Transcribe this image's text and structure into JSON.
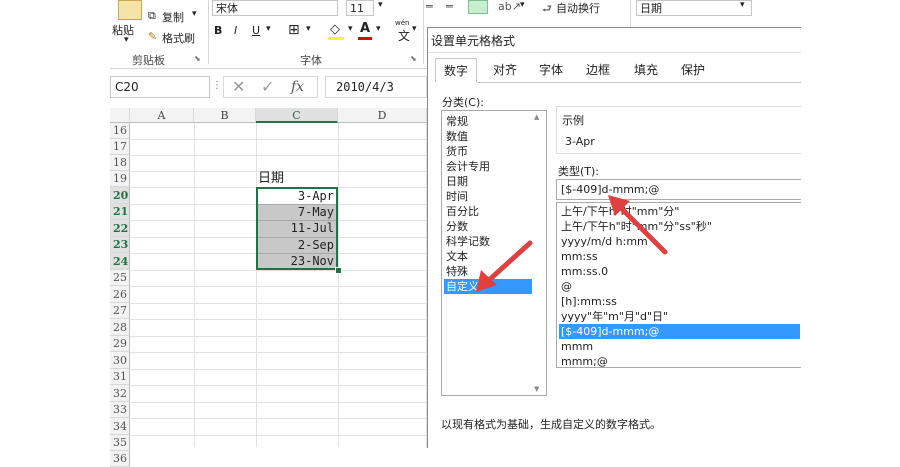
{
  "ribbon": {
    "paste_label": "粘贴",
    "copy_label": "复制",
    "format_painter_label": "格式刷",
    "clipboard_group": "剪贴板",
    "font_name": "宋体",
    "font_size": "11",
    "bold": "B",
    "italic": "I",
    "underline": "U",
    "font_group": "字体",
    "wrap_text_label": "自动换行",
    "number_format": "日期",
    "wen_label": "wén",
    "wen_char": "文"
  },
  "formula_bar": {
    "name_box": "C20",
    "fx": "fx",
    "value": "2010/4/3"
  },
  "grid": {
    "columns": [
      "A",
      "B",
      "C",
      "D"
    ],
    "rows": [
      "16",
      "17",
      "18",
      "19",
      "20",
      "21",
      "22",
      "23",
      "24",
      "25",
      "26",
      "27",
      "28",
      "29",
      "30",
      "31",
      "32",
      "33",
      "34",
      "35",
      "36"
    ],
    "header_cell": "日期",
    "date_cells": [
      "3-Apr",
      "7-May",
      "11-Jul",
      "2-Sep",
      "23-Nov"
    ]
  },
  "dialog": {
    "title": "设置单元格格式",
    "tabs": [
      "数字",
      "对齐",
      "字体",
      "边框",
      "填充",
      "保护"
    ],
    "category_label": "分类(C):",
    "categories": [
      "常规",
      "数值",
      "货币",
      "会计专用",
      "日期",
      "时间",
      "百分比",
      "分数",
      "科学记数",
      "文本",
      "特殊",
      "自定义"
    ],
    "selected_category": "自定义",
    "sample_label": "示例",
    "sample_value": "3-Apr",
    "type_label": "类型(T):",
    "type_value": "[$-409]d-mmm;@",
    "type_list": [
      "上午/下午h\"时\"mm\"分\"",
      "上午/下午h\"时\"mm\"分\"ss\"秒\"",
      "yyyy/m/d h:mm",
      "mm:ss",
      "mm:ss.0",
      "@",
      "[h]:mm:ss",
      "yyyy\"年\"m\"月\"d\"日\"",
      "[$-409]d-mmm;@",
      "mmm",
      "mmm;@"
    ],
    "description": "以现有格式为基础，生成自定义的数字格式。"
  },
  "colors": {
    "excel_green": "#217346",
    "selection_blue": "#3399ff",
    "arrow_red": "#e04040"
  }
}
